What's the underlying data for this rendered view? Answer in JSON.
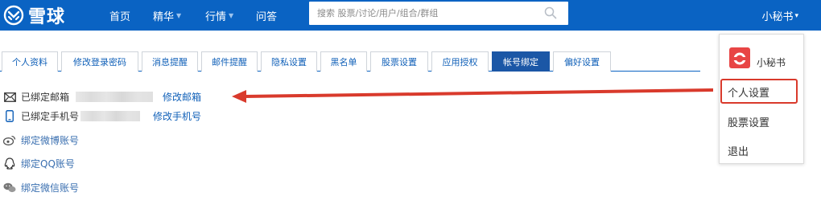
{
  "brand": {
    "name": "雪球"
  },
  "nav": {
    "items": [
      {
        "label": "首页",
        "has_caret": false
      },
      {
        "label": "精华",
        "has_caret": true
      },
      {
        "label": "行情",
        "has_caret": true
      },
      {
        "label": "问答",
        "has_caret": false
      }
    ]
  },
  "search": {
    "placeholder": "搜索 股票/讨论/用户/组合/群组",
    "icon": "search-icon"
  },
  "user": {
    "name": "小秘书",
    "caret": "▾"
  },
  "tabs": [
    {
      "label": "个人资料",
      "active": false
    },
    {
      "label": "修改登录密码",
      "active": false
    },
    {
      "label": "消息提醒",
      "active": false
    },
    {
      "label": "邮件提醒",
      "active": false
    },
    {
      "label": "隐私设置",
      "active": false
    },
    {
      "label": "黑名单",
      "active": false
    },
    {
      "label": "股票设置",
      "active": false
    },
    {
      "label": "应用授权",
      "active": false
    },
    {
      "label": "帐号绑定",
      "active": true
    },
    {
      "label": "偏好设置",
      "active": false
    }
  ],
  "bindings": {
    "email": {
      "label": "已绑定邮箱",
      "action": "修改邮箱",
      "icon": "mail-icon"
    },
    "phone": {
      "label": "已绑定手机号",
      "action": "修改手机号",
      "icon": "phone-icon"
    },
    "weibo": {
      "label": "绑定微博账号",
      "icon": "weibo-icon"
    },
    "qq": {
      "label": "绑定QQ账号",
      "icon": "qq-icon"
    },
    "wechat": {
      "label": "绑定微信账号",
      "icon": "wechat-icon"
    }
  },
  "dropdown": {
    "name": "小秘书",
    "items": [
      "个人设置",
      "股票设置",
      "退出"
    ]
  },
  "colors": {
    "nav_bg": "#0a63c3",
    "active_tab": "#1b57a6",
    "annotation": "#d93a2c",
    "link": "#1060b8"
  }
}
